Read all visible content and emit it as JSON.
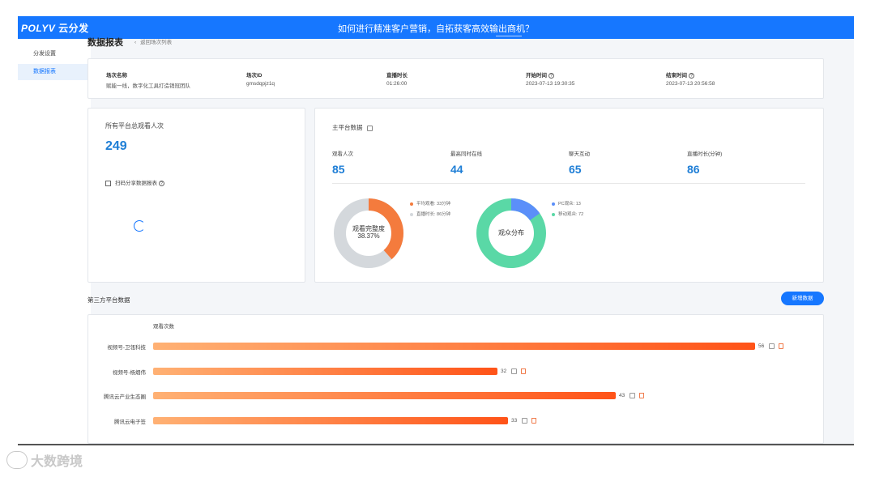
{
  "topbar": {
    "logo_brand": "POLYV",
    "logo_suffix": "云分发",
    "headline": "如何进行精准客户营销，自拓获客高效输出商机？"
  },
  "sidebar": {
    "items": [
      {
        "label": "分发设置"
      },
      {
        "label": "数据报表",
        "active": true
      }
    ]
  },
  "page": {
    "title": "数据报表",
    "back_label": "返回场次列表"
  },
  "session": {
    "name_label": "场次名称",
    "name_value": "赋能一线，数字化工具打造销冠团队",
    "id_label": "场次ID",
    "id_value": "gmsdqpjz1q",
    "duration_label": "直播时长",
    "duration_value": "01:26:00",
    "start_label": "开始时间",
    "start_value": "2023-07-13 19:30:35",
    "end_label": "结束时间",
    "end_value": "2023-07-13 20:56:58"
  },
  "total": {
    "label": "所有平台总观看人次",
    "value": "249",
    "qr_label": "扫码分享数据报表"
  },
  "main_platform": {
    "title": "主平台数据",
    "stats": [
      {
        "label": "观看人次",
        "value": "85"
      },
      {
        "label": "最高同时在线",
        "value": "44"
      },
      {
        "label": "聊天互动",
        "value": "65"
      },
      {
        "label": "直播时长(分钟)",
        "value": "86"
      }
    ],
    "completion": {
      "center_label": "观看完整度",
      "center_value": "38.37%",
      "avg_watch_minutes": 33,
      "live_minutes": 86,
      "legend_avg": "平均观看: 33分钟",
      "legend_live": "直播时长: 86分钟",
      "color_avg": "#f47b3d",
      "color_rest": "#d4d8dc"
    },
    "audience": {
      "center_label": "观众分布",
      "pc": 13,
      "mobile": 72,
      "legend_pc": "PC观众: 13",
      "legend_mobile": "移动观众: 72",
      "color_pc": "#5b8ff9",
      "color_mobile": "#5ad8a6"
    }
  },
  "third_party": {
    "title": "第三方平台数据",
    "add_button": "新增数据",
    "axis_title": "观看次数",
    "max": 56,
    "rows": [
      {
        "name": "视频号-卫瓴科技",
        "value": 56
      },
      {
        "name": "视频号-杨烟伟",
        "value": 32
      },
      {
        "name": "腾讯云产业生态圈",
        "value": 43
      },
      {
        "name": "腾讯云电子签",
        "value": 33
      }
    ]
  },
  "watermark": {
    "text": "大数跨境"
  }
}
